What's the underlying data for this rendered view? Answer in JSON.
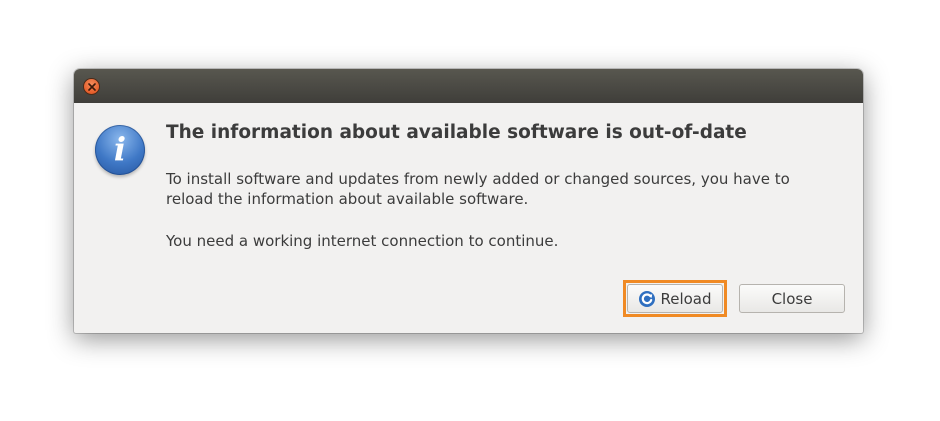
{
  "dialog": {
    "title": "The information about available software is out-of-date",
    "paragraph1": "To install software and updates from newly added or changed sources, you have to reload the information about available software.",
    "paragraph2": "You need a working internet connection to continue.",
    "icon": "info-icon",
    "buttons": {
      "reload_label": "Reload",
      "reload_icon": "reload-icon",
      "close_label": "Close"
    },
    "highlight_color": "#f08a24",
    "titlebar_close_color": "#df4a16"
  }
}
